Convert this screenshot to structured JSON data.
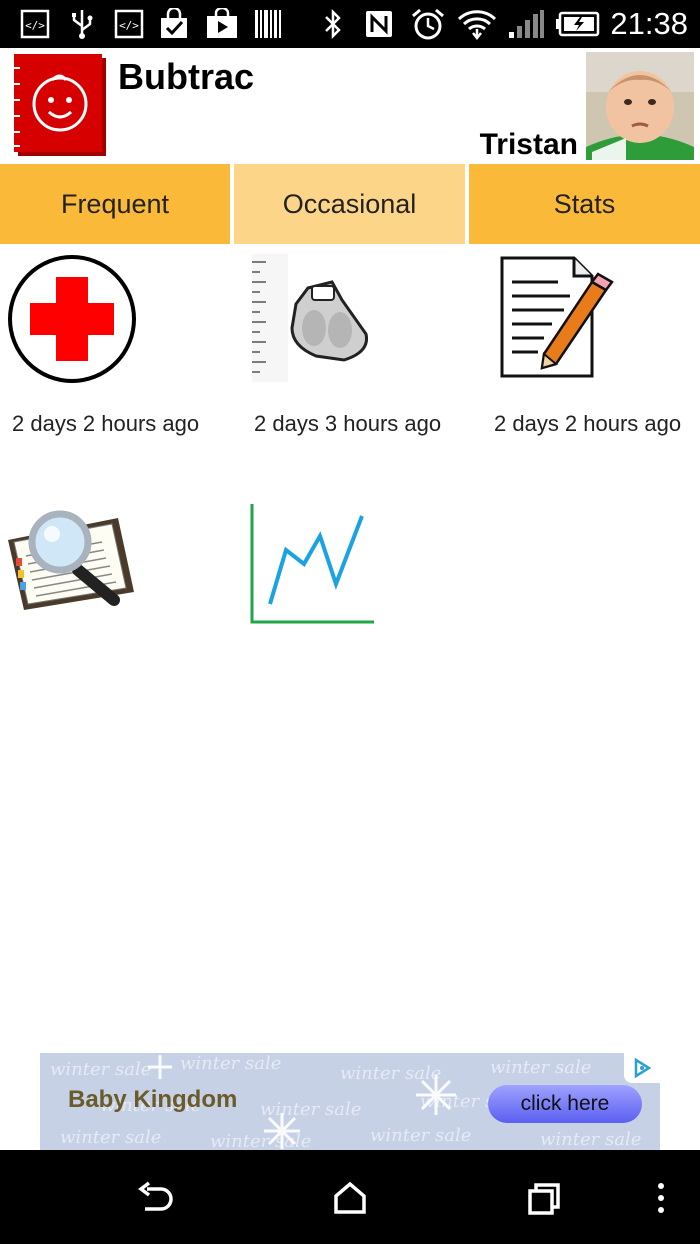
{
  "status_bar": {
    "time": "21:38",
    "icons": [
      "debug-icon",
      "usb-icon",
      "debug-icon",
      "shopping-bag-check-icon",
      "play-store-icon",
      "barcode-icon",
      "bluetooth-icon",
      "nfc-icon",
      "alarm-clock-icon",
      "wifi-icon",
      "signal-icon",
      "battery-charging-icon"
    ]
  },
  "header": {
    "app_title": "Bubtrac",
    "child_name": "Tristan",
    "logo_icon": "baby-face-logo-icon",
    "photo": "child-avatar"
  },
  "tabs": [
    {
      "label": "Frequent"
    },
    {
      "label": "Occasional"
    },
    {
      "label": "Stats"
    }
  ],
  "tiles": [
    {
      "icon": "medical-cross-icon",
      "time_ago": "2 days 2 hours ago"
    },
    {
      "icon": "weighing-scale-icon",
      "time_ago": "2 days 3 hours ago"
    },
    {
      "icon": "notepad-pencil-icon",
      "time_ago": "2 days 2 hours ago"
    },
    {
      "icon": "journal-search-icon",
      "time_ago": ""
    },
    {
      "icon": "line-chart-icon",
      "time_ago": ""
    }
  ],
  "ad": {
    "brand": "Baby Kingdom",
    "button_label": "click here",
    "background_text": "winter sale"
  },
  "nav": {
    "icons": [
      "back-icon",
      "home-icon",
      "recent-apps-icon",
      "overflow-menu-icon"
    ]
  },
  "colors": {
    "tab_active": "#fbb93a",
    "tab_selected": "#fdd588",
    "logo_red": "#d60000",
    "cross_red": "#ff0000",
    "chart_blue": "#1aa3e0",
    "chart_green": "#21a54a"
  }
}
